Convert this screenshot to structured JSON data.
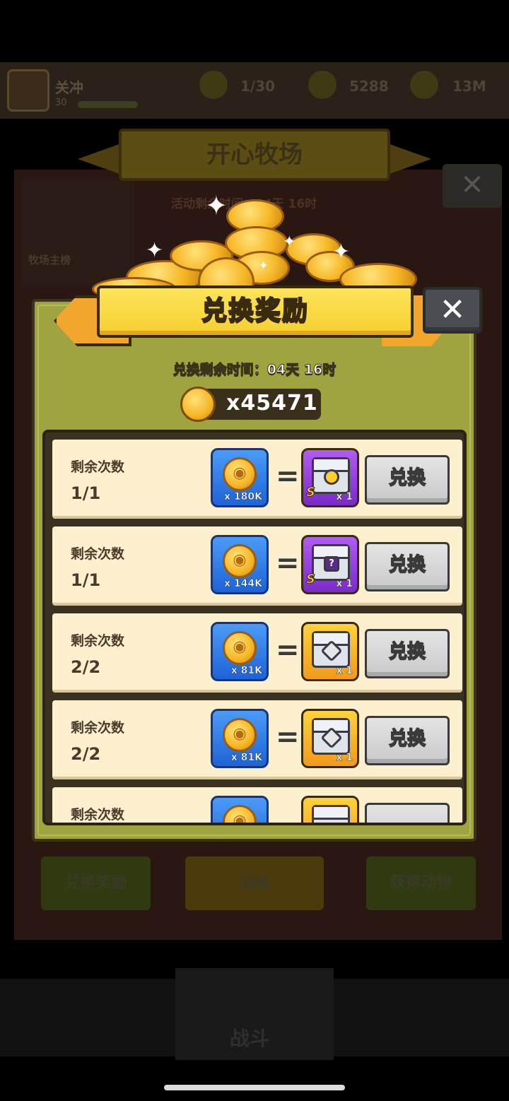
{
  "background": {
    "player_name": "关冲",
    "player_level": "30",
    "stats": [
      "1/30",
      "5288",
      "13M"
    ],
    "event_title": "开心牧场",
    "event_timer": "活动剩余时间：04天 16时",
    "rank_label": "牧场主榜",
    "bottom_buttons": [
      "兑换奖励",
      "回收",
      "获得动物"
    ],
    "nav_center_label": "战斗"
  },
  "dialog": {
    "title": "兑换奖励",
    "close_symbol": "✕",
    "time_remaining": "兑换剩余时间：04天 16时",
    "balance": "x45471"
  },
  "exchange_list": {
    "rows": [
      {
        "label": "剩余次数",
        "count": "1/1",
        "cost": "x 180K",
        "equals": "=",
        "reward_badge": "S",
        "reward_mark": "",
        "reward_qty": "x 1",
        "button": "兑换"
      },
      {
        "label": "剩余次数",
        "count": "1/1",
        "cost": "x 144K",
        "equals": "=",
        "reward_badge": "S",
        "reward_mark": "?",
        "reward_qty": "x 1",
        "button": "兑换"
      },
      {
        "label": "剩余次数",
        "count": "2/2",
        "cost": "x 81K",
        "equals": "=",
        "reward_badge": "",
        "reward_mark": "",
        "reward_qty": "x 1",
        "button": "兑换"
      },
      {
        "label": "剩余次数",
        "count": "2/2",
        "cost": "x 81K",
        "equals": "=",
        "reward_badge": "",
        "reward_mark": "",
        "reward_qty": "x 1",
        "button": "兑换"
      },
      {
        "label": "剩余次数",
        "count": "",
        "cost": "",
        "equals": "",
        "reward_badge": "",
        "reward_mark": "",
        "reward_qty": "",
        "button": ""
      }
    ]
  },
  "colors": {
    "dialog_bg": "#9fa441",
    "title_plate": "#fde45b",
    "cost_tile": "#1e63d6",
    "reward_purple": "#7a2bc7",
    "reward_gold": "#f09a1c",
    "button_gray": "#c9c9c9"
  },
  "icons": [
    "pig-coin-icon",
    "treasure-chest-icon",
    "mystery-chest-icon",
    "close-icon",
    "sparkle-icon"
  ]
}
